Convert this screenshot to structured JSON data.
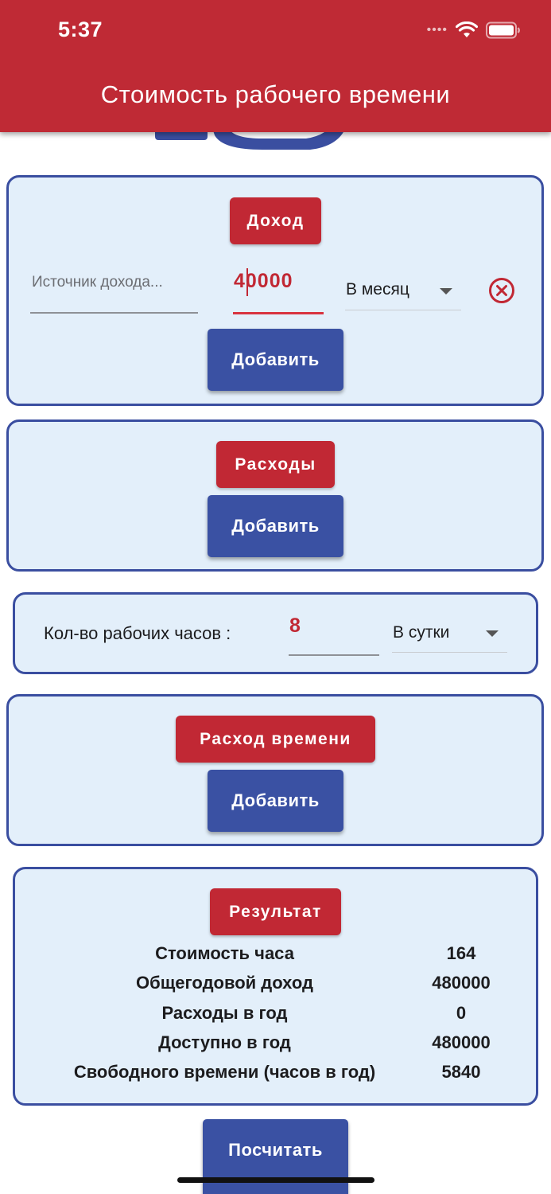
{
  "status_bar": {
    "time": "5:37"
  },
  "header": {
    "title": "Стоимость рабочего времени"
  },
  "colors": {
    "primary_red": "#bf2a35",
    "primary_blue": "#3a51a3",
    "card_bg": "#e3effa",
    "card_border": "#3a4ea0"
  },
  "income": {
    "title": "Доход",
    "source_placeholder": "Источник дохода...",
    "amount_value": "40000",
    "period_selected": "В месяц",
    "add_label": "Добавить"
  },
  "expenses": {
    "title": "Расходы",
    "add_label": "Добавить"
  },
  "hours": {
    "label": "Кол-во рабочих часов :",
    "value": "8",
    "period_selected": "В сутки"
  },
  "time_expense": {
    "title": "Расход времени",
    "add_label": "Добавить"
  },
  "result": {
    "title": "Результат",
    "rows": [
      {
        "label": "Стоимость часа",
        "value": "164"
      },
      {
        "label": "Общегодовой доход",
        "value": "480000"
      },
      {
        "label": "Расходы в год",
        "value": "0"
      },
      {
        "label": "Доступно в год",
        "value": "480000"
      },
      {
        "label": "Свободного времени (часов в год)",
        "value": "5840"
      }
    ]
  },
  "calculate": {
    "label": "Посчитать"
  }
}
